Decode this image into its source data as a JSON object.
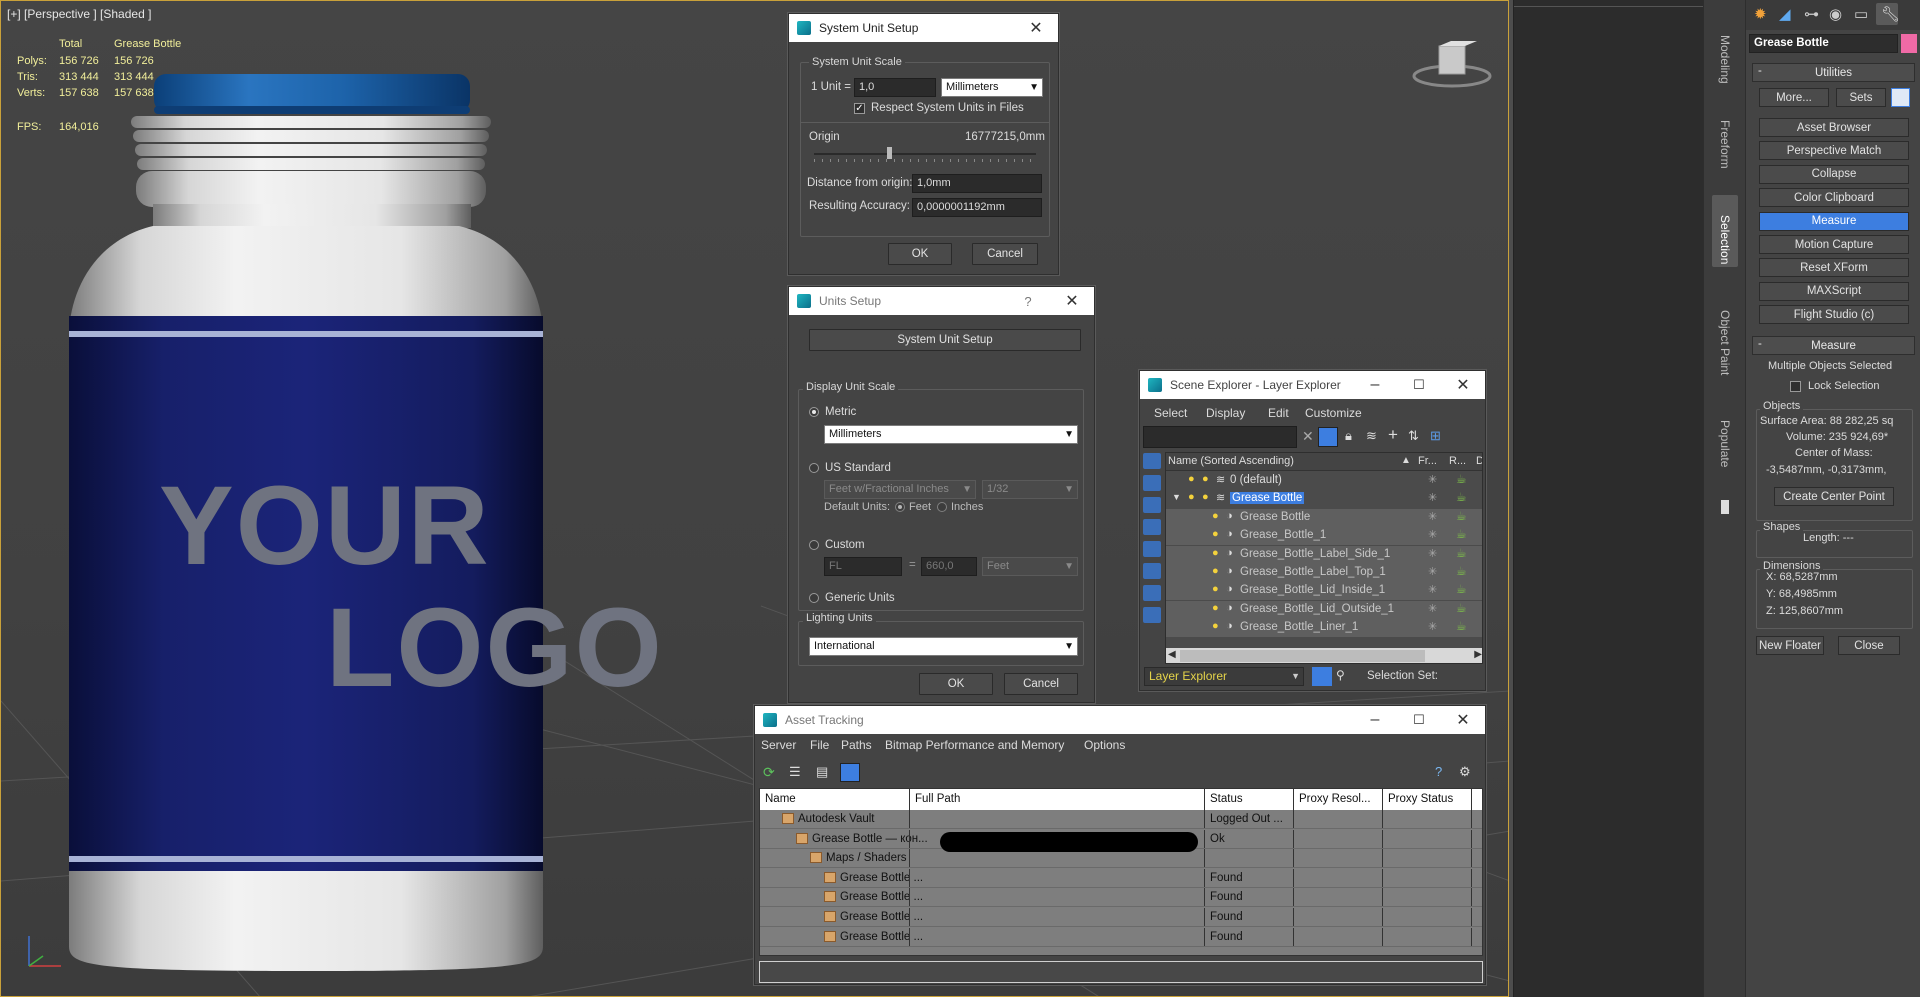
{
  "viewport": {
    "label": "[+] [Perspective ] [Shaded ]",
    "stats": {
      "total_header": "Total",
      "object_header": "Grease Bottle",
      "rows": [
        {
          "label": "Polys:",
          "total": "156 726",
          "object": "156 726"
        },
        {
          "label": "Tris:",
          "total": "313 444",
          "object": "313 444"
        },
        {
          "label": "Verts:",
          "total": "157 638",
          "object": "157 638"
        }
      ],
      "fps_label": "FPS:",
      "fps_value": "164,016"
    },
    "logo_line1": "YOUR",
    "logo_line2": "LOGO",
    "axis_x": "x",
    "axis_y": "y",
    "axis_z": "z"
  },
  "system_unit_setup": {
    "title": "System Unit Setup",
    "group_label": "System Unit Scale",
    "unit_label": "1 Unit =",
    "unit_value": "1,0",
    "unit_dropdown": "Millimeters",
    "respect_label": "Respect System Units in Files",
    "origin_label": "Origin",
    "origin_value": "16777215,0mm",
    "distance_label": "Distance from origin:",
    "distance_value": "1,0mm",
    "accuracy_label": "Resulting Accuracy:",
    "accuracy_value": "0,0000001192mm",
    "ok": "OK",
    "cancel": "Cancel"
  },
  "units_setup": {
    "title": "Units Setup",
    "help": "?",
    "system_button": "System Unit Setup",
    "display_group": "Display Unit Scale",
    "metric_label": "Metric",
    "metric_value": "Millimeters",
    "us_label": "US Standard",
    "us_value": "Feet w/Fractional Inches",
    "us_fraction": "1/32",
    "default_units_label": "Default Units:",
    "feet_label": "Feet",
    "inches_label": "Inches",
    "custom_label": "Custom",
    "custom_name": "FL",
    "custom_eq": "=",
    "custom_value": "660,0",
    "custom_unit": "Feet",
    "generic_label": "Generic Units",
    "lighting_group": "Lighting Units",
    "lighting_value": "International",
    "ok": "OK",
    "cancel": "Cancel"
  },
  "scene_explorer": {
    "title": "Scene Explorer - Layer Explorer",
    "menu": [
      "Select",
      "Display",
      "Edit",
      "Customize"
    ],
    "col_name": "Name (Sorted Ascending)",
    "col_fr": "Fr...",
    "col_r": "R...",
    "col_d": "D",
    "rows": [
      {
        "name": "0 (default)",
        "level": 0,
        "selected": false,
        "grey": false
      },
      {
        "name": "Grease Bottle",
        "level": 0,
        "selected": true,
        "grey": false
      },
      {
        "name": "Grease Bottle",
        "level": 1,
        "selected": false,
        "grey": true
      },
      {
        "name": "Grease_Bottle_1",
        "level": 1,
        "selected": false,
        "grey": true
      },
      {
        "name": "Grease_Bottle_Label_Side_1",
        "level": 1,
        "selected": false,
        "grey": true
      },
      {
        "name": "Grease_Bottle_Label_Top_1",
        "level": 1,
        "selected": false,
        "grey": true
      },
      {
        "name": "Grease_Bottle_Lid_Inside_1",
        "level": 1,
        "selected": false,
        "grey": true
      },
      {
        "name": "Grease_Bottle_Lid_Outside_1",
        "level": 1,
        "selected": false,
        "grey": true
      },
      {
        "name": "Grease_Bottle_Liner_1",
        "level": 1,
        "selected": false,
        "grey": true
      }
    ],
    "footer_explorer": "Layer Explorer",
    "selection_set": "Selection Set:"
  },
  "asset_tracking": {
    "title": "Asset Tracking",
    "menu": [
      "Server",
      "File",
      "Paths",
      "Bitmap Performance and Memory",
      "Options"
    ],
    "columns": [
      "Name",
      "Full Path",
      "Status",
      "Proxy Resol...",
      "Proxy Status"
    ],
    "rows": [
      {
        "name": "Autodesk Vault",
        "indent": 1,
        "status": "Logged Out ..."
      },
      {
        "name": "Grease Bottle — кон...",
        "indent": 2,
        "status": "Ok"
      },
      {
        "name": "Maps / Shaders",
        "indent": 3,
        "status": ""
      },
      {
        "name": "Grease Bottle ...",
        "indent": 4,
        "status": "Found"
      },
      {
        "name": "Grease Bottle ...",
        "indent": 4,
        "status": "Found"
      },
      {
        "name": "Grease Bottle ...",
        "indent": 4,
        "status": "Found"
      },
      {
        "name": "Grease Bottle ...",
        "indent": 4,
        "status": "Found"
      }
    ]
  },
  "ribbon_tabs": [
    "Modeling",
    "Freeform",
    "Selection",
    "Object Paint",
    "Populate"
  ],
  "command_panel": {
    "object_name": "Grease Bottle",
    "utilities_title": "Utilities",
    "more": "More...",
    "sets": "Sets",
    "utilities": [
      "Asset Browser",
      "Perspective Match",
      "Collapse",
      "Color Clipboard",
      "Measure",
      "Motion Capture",
      "Reset XForm",
      "MAXScript",
      "Flight Studio (c)"
    ],
    "active_utility": "Measure",
    "measure_title": "Measure",
    "multiple_selected": "Multiple Objects Selected",
    "lock_selection": "Lock Selection",
    "objects_label": "Objects",
    "surface_area": "Surface Area: 88 282,25 sq",
    "volume": "Volume: 235 924,69*",
    "center_of_mass": "Center of Mass:",
    "center_values": "-3,5487mm, -0,3173mm,",
    "create_center": "Create Center Point",
    "shapes_label": "Shapes",
    "length": "Length: ---",
    "dimensions_label": "Dimensions",
    "dim_x": "X:  68,5287mm",
    "dim_y": "Y:  68,4985mm",
    "dim_z": "Z:  125,8607mm",
    "new_floater": "New Floater",
    "close": "Close"
  }
}
